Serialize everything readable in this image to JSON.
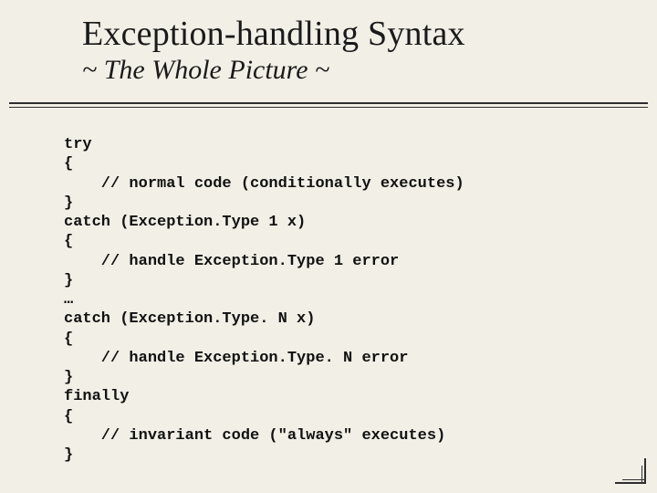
{
  "header": {
    "title": "Exception-handling Syntax",
    "subtitle": "~ The Whole Picture ~"
  },
  "code": {
    "lines": [
      "try",
      "{",
      "    // normal code (conditionally executes)",
      "}",
      "catch (Exception.Type 1 x)",
      "{",
      "    // handle Exception.Type 1 error",
      "}",
      "…",
      "catch (Exception.Type. N x)",
      "{",
      "    // handle Exception.Type. N error",
      "}",
      "finally",
      "{",
      "    // invariant code (\"always\" executes)",
      "}"
    ]
  }
}
